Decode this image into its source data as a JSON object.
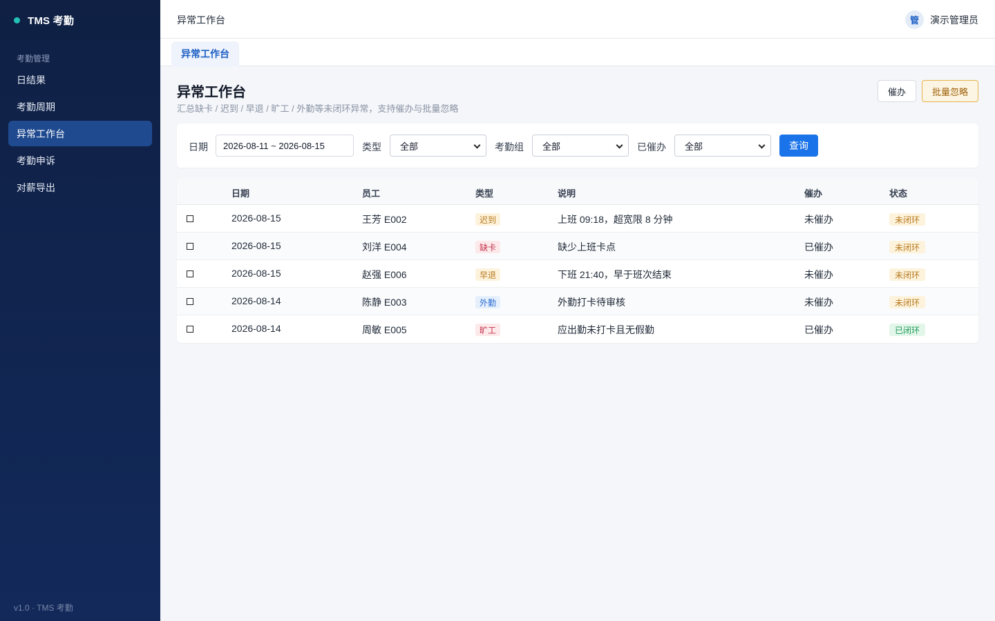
{
  "app": {
    "brand": "TMS 考勤",
    "version": "v1.0 · TMS 考勤"
  },
  "sidebar": {
    "section": "考勤管理",
    "items": [
      {
        "label": "日结果",
        "active": false
      },
      {
        "label": "考勤周期",
        "active": false
      },
      {
        "label": "异常工作台",
        "active": true
      },
      {
        "label": "考勤申诉",
        "active": false
      },
      {
        "label": "对薪导出",
        "active": false
      }
    ]
  },
  "header": {
    "title": "异常工作台",
    "avatar": "管",
    "user": "演示管理员"
  },
  "tabs": [
    {
      "label": "异常工作台"
    }
  ],
  "page": {
    "title": "异常工作台",
    "subtitle": "汇总缺卡 / 迟到 / 早退 / 旷工 / 外勤等未闭环异常，支持催办与批量忽略",
    "urge_label": "催办",
    "ignore_label": "批量忽略"
  },
  "filters": {
    "date_label": "日期",
    "date_value": "2026-08-11 ~ 2026-08-15",
    "type_label": "类型",
    "type_value": "全部",
    "group_label": "考勤组",
    "group_value": "全部",
    "urged_label": "已催办",
    "urged_value": "全部",
    "query_label": "查询"
  },
  "table": {
    "columns": [
      "日期",
      "员工",
      "类型",
      "说明",
      "催办",
      "状态"
    ],
    "rows": [
      {
        "date": "2026-08-15",
        "employee": "王芳 E002",
        "type": "迟到",
        "type_color": "#b7791f",
        "type_bg": "#fdf3dc",
        "desc": "上班 09:18，超宽限 8 分钟",
        "urge": "未催办",
        "status": "未闭环",
        "status_color": "#b7791f",
        "status_bg": "#fdf3dc"
      },
      {
        "date": "2026-08-15",
        "employee": "刘洋 E004",
        "type": "缺卡",
        "type_color": "#c2334d",
        "type_bg": "#fde8ea",
        "desc": "缺少上班卡点",
        "urge": "已催办",
        "status": "未闭环",
        "status_color": "#b7791f",
        "status_bg": "#fdf3dc"
      },
      {
        "date": "2026-08-15",
        "employee": "赵强 E006",
        "type": "早退",
        "type_color": "#b7791f",
        "type_bg": "#fdf3dc",
        "desc": "下班 21:40，早于班次结束",
        "urge": "未催办",
        "status": "未闭环",
        "status_color": "#b7791f",
        "status_bg": "#fdf3dc"
      },
      {
        "date": "2026-08-14",
        "employee": "陈静 E003",
        "type": "外勤",
        "type_color": "#2b6cd1",
        "type_bg": "#e6f0fd",
        "desc": "外勤打卡待审核",
        "urge": "未催办",
        "status": "未闭环",
        "status_color": "#b7791f",
        "status_bg": "#fdf3dc"
      },
      {
        "date": "2026-08-14",
        "employee": "周敏 E005",
        "type": "旷工",
        "type_color": "#c2334d",
        "type_bg": "#fde8ea",
        "desc": "应出勤未打卡且无假勤",
        "urge": "已催办",
        "status": "已闭环",
        "status_color": "#1f9a5a",
        "status_bg": "#e3f6ea"
      }
    ]
  }
}
